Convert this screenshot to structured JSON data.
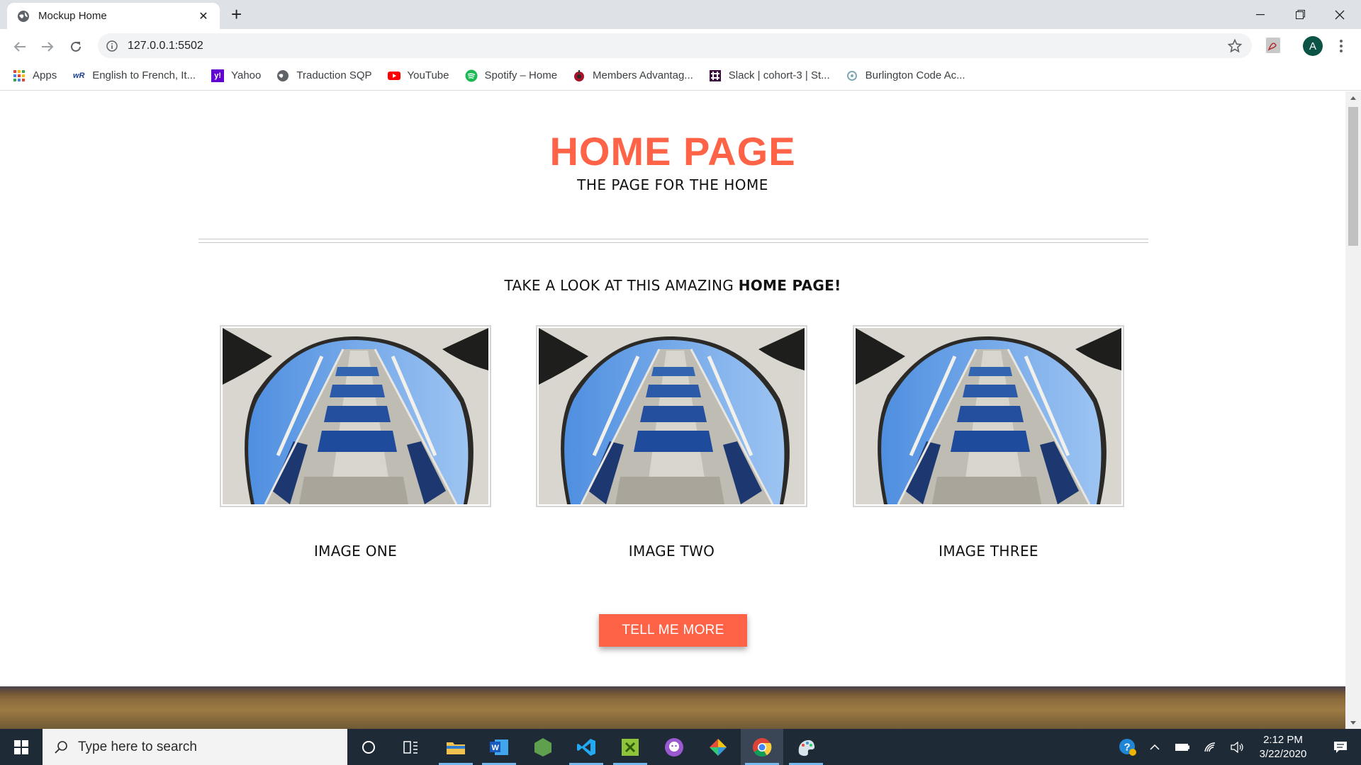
{
  "browser": {
    "tab_title": "Mockup Home",
    "url": "127.0.0.1:5502",
    "profile_initial": "A",
    "bookmarks": [
      {
        "label": "Apps",
        "icon": "apps-grid-icon"
      },
      {
        "label": "English to French, It...",
        "icon": "wordreference-icon"
      },
      {
        "label": "Yahoo",
        "icon": "yahoo-icon"
      },
      {
        "label": "Traduction SQP",
        "icon": "globe-icon"
      },
      {
        "label": "YouTube",
        "icon": "youtube-icon"
      },
      {
        "label": "Spotify – Home",
        "icon": "spotify-icon"
      },
      {
        "label": "Members Advantag...",
        "icon": "apple-icon"
      },
      {
        "label": "Slack | cohort-3 | St...",
        "icon": "slack-icon"
      },
      {
        "label": "Burlington Code Ac...",
        "icon": "burlington-icon"
      }
    ]
  },
  "page": {
    "title": "HOME PAGE",
    "subtitle": "THE PAGE FOR THE HOME",
    "lead_prefix": "TAKE A LOOK AT THIS AMAZING ",
    "lead_bold": "HOME PAGE!",
    "cards": [
      {
        "caption": "IMAGE ONE"
      },
      {
        "caption": "IMAGE TWO"
      },
      {
        "caption": "IMAGE THREE"
      }
    ],
    "cta_label": "TELL ME MORE",
    "accent_color": "#fe6347"
  },
  "taskbar": {
    "search_placeholder": "Type here to search",
    "time": "2:12 PM",
    "date": "3/22/2020"
  }
}
